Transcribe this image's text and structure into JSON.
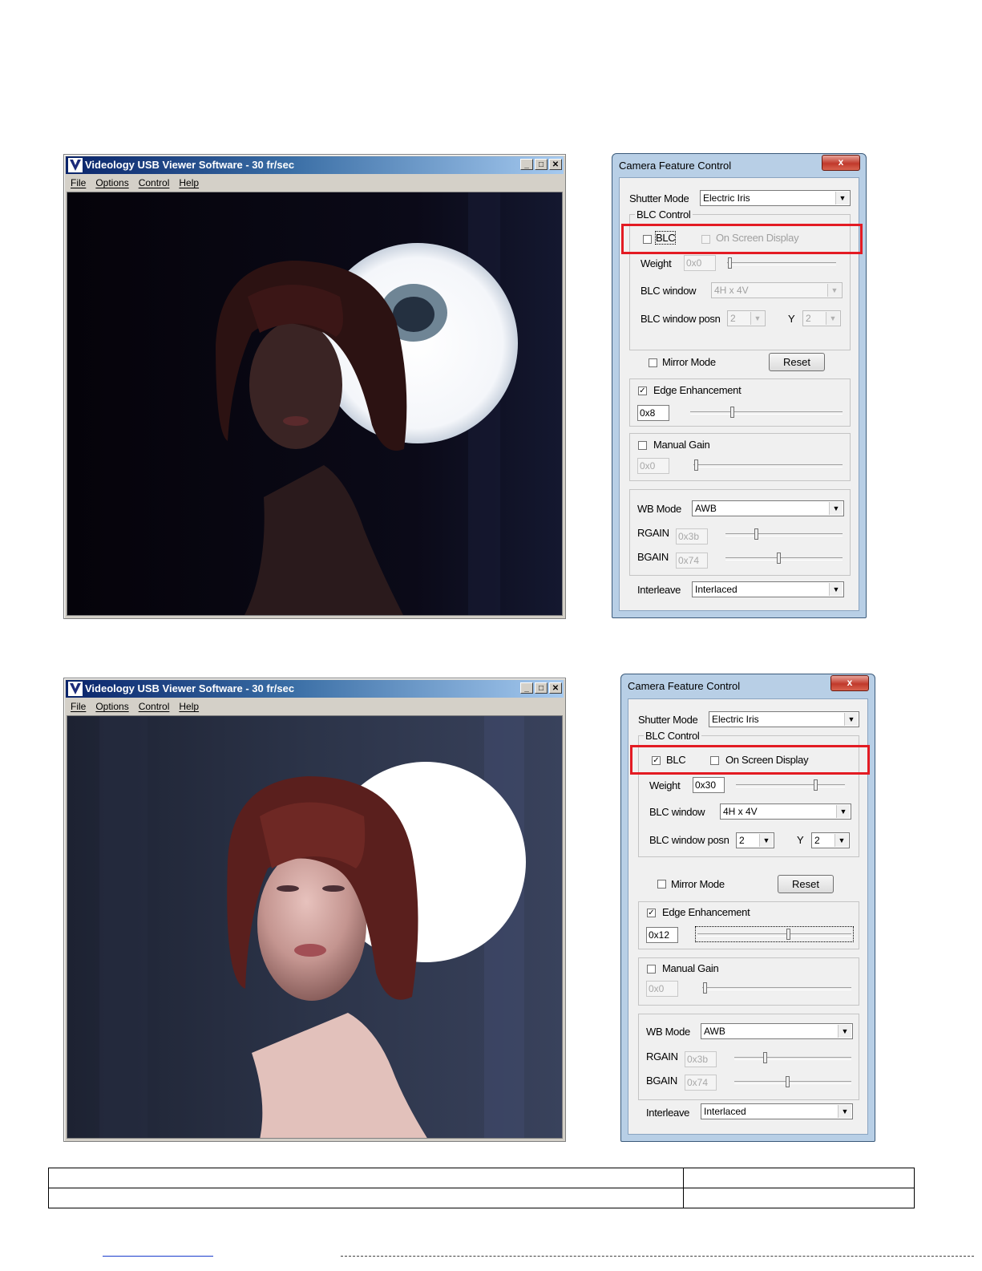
{
  "viewers": [
    {
      "title": "Videology USB Viewer Software - 30 fr/sec",
      "menu": [
        "File",
        "Options",
        "Control",
        "Help"
      ],
      "window_buttons": [
        "minimize-icon",
        "maximize-icon",
        "close-icon"
      ],
      "image": "dark mannequin portrait, BLC off"
    },
    {
      "title": "Videology USB Viewer Software - 30 fr/sec",
      "menu": [
        "File",
        "Options",
        "Control",
        "Help"
      ],
      "window_buttons": [
        "minimize-icon",
        "maximize-icon",
        "close-icon"
      ],
      "image": "bright mannequin portrait, BLC on"
    }
  ],
  "panels": [
    {
      "title": "Camera Feature Control",
      "close_label": "x",
      "shutter_mode_label": "Shutter Mode",
      "shutter_mode_value": "Electric Iris",
      "blc_group_label": "BLC Control",
      "blc_label": "BLC",
      "blc_checked": false,
      "osd_label": "On Screen Display",
      "osd_checked": false,
      "weight_label": "Weight",
      "weight_value": "0x0",
      "weight_level": 0.0,
      "blc_window_label": "BLC window",
      "blc_window_value": "4H x 4V",
      "blc_posn_label": "BLC window posn",
      "blc_posn_x": "2",
      "y_label": "Y",
      "blc_posn_y": "2",
      "mirror_label": "Mirror Mode",
      "mirror_checked": false,
      "reset_label": "Reset",
      "edge_label": "Edge Enhancement",
      "edge_checked": true,
      "edge_value": "0x8",
      "edge_level": 0.27,
      "gain_label": "Manual Gain",
      "gain_checked": false,
      "gain_value": "0x0",
      "gain_level": 0.0,
      "wb_label": "WB Mode",
      "wb_value": "AWB",
      "rgain_label": "RGAIN",
      "rgain_value": "0x3b",
      "rgain_level": 0.25,
      "bgain_label": "BGAIN",
      "bgain_value": "0x74",
      "bgain_level": 0.46,
      "interleave_label": "Interleave",
      "interleave_value": "Interlaced"
    },
    {
      "title": "Camera Feature Control",
      "close_label": "x",
      "shutter_mode_label": "Shutter Mode",
      "shutter_mode_value": "Electric Iris",
      "blc_group_label": "BLC Control",
      "blc_label": "BLC",
      "blc_checked": true,
      "osd_label": "On Screen Display",
      "osd_checked": false,
      "weight_label": "Weight",
      "weight_value": "0x30",
      "weight_level": 0.75,
      "blc_window_label": "BLC window",
      "blc_window_value": "4H x 4V",
      "blc_posn_label": "BLC window posn",
      "blc_posn_x": "2",
      "y_label": "Y",
      "blc_posn_y": "2",
      "mirror_label": "Mirror Mode",
      "mirror_checked": false,
      "reset_label": "Reset",
      "edge_label": "Edge Enhancement",
      "edge_checked": true,
      "edge_value": "0x12",
      "edge_level": 0.6,
      "gain_label": "Manual Gain",
      "gain_checked": false,
      "gain_value": "0x0",
      "gain_level": 0.0,
      "wb_label": "WB Mode",
      "wb_value": "AWB",
      "rgain_label": "RGAIN",
      "rgain_value": "0x3b",
      "rgain_level": 0.25,
      "bgain_label": "BGAIN",
      "bgain_value": "0x74",
      "bgain_level": 0.46,
      "interleave_label": "Interleave",
      "interleave_value": "Interlaced"
    }
  ],
  "colors": {
    "highlight": "#e31b23",
    "xp_title": "#0a246a",
    "vista_frame": "#b8cfe6"
  }
}
